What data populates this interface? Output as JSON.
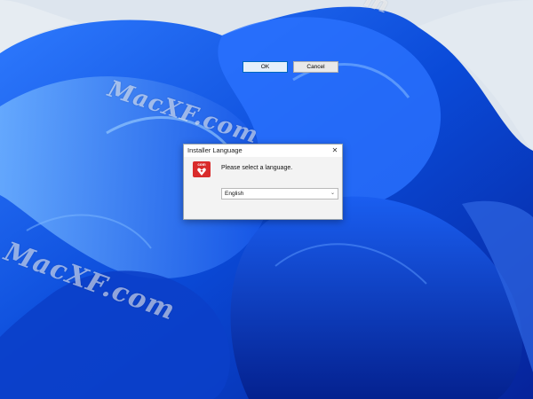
{
  "desktop": {
    "watermarks": [
      "MacXF.com",
      "MacXF.com",
      "m"
    ]
  },
  "dialog": {
    "title": "Installer Language",
    "close_glyph": "✕",
    "app_icon": {
      "name": "installer-app-icon",
      "label": "com"
    },
    "prompt": "Please select a language.",
    "language_select": {
      "value": "English",
      "chevron": "⌄"
    },
    "ok_label": "OK",
    "cancel_label": "Cancel"
  },
  "colors": {
    "accent": "#0067c0",
    "wallpaper_blue": "#0a47d6",
    "wallpaper_light": "#dfe6ee",
    "icon_red": "#d92b2b"
  }
}
